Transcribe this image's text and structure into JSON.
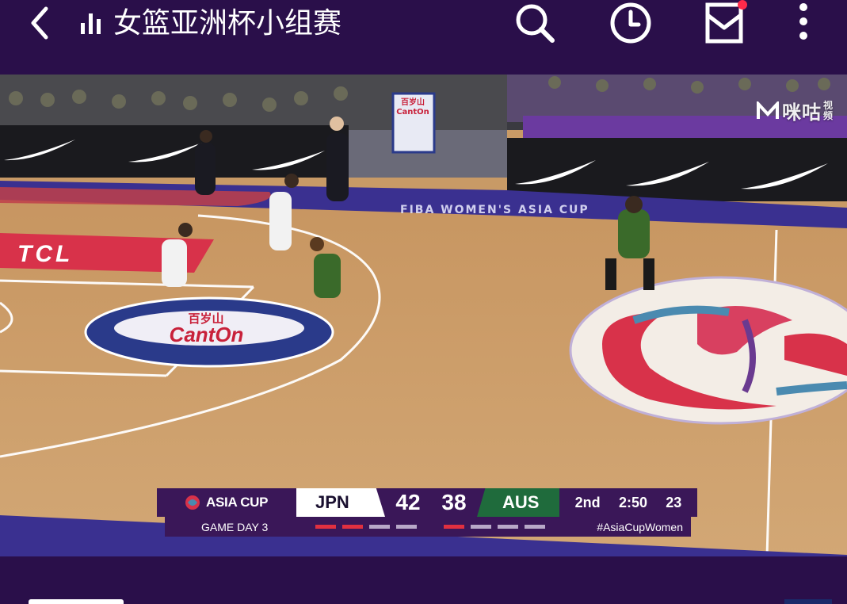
{
  "appbar": {
    "back_icon": "chevron-left-icon",
    "live_icon": "signal-bars-icon",
    "title": "女篮亚洲杯小组赛",
    "actions": [
      {
        "name": "search-icon"
      },
      {
        "name": "history-clock-icon"
      },
      {
        "name": "inbox-icon",
        "has_badge": true
      },
      {
        "name": "more-vertical-icon"
      }
    ],
    "badge_color": "#ff2a4a"
  },
  "video": {
    "watermark_brand": "咪咕",
    "watermark_sub": "视频",
    "ad_board_text": "FIBA WOMEN'S ASIA CUP",
    "court_logo_left": "TCL",
    "center_logo_top": "百岁山",
    "center_logo_main": "CantOn",
    "pillar_text": "百岁山 CantOn"
  },
  "scoreboard": {
    "event": "ASIA CUP",
    "home_team": "JPN",
    "home_score": "42",
    "away_score": "38",
    "away_team": "AUS",
    "period": "2nd",
    "game_clock": "2:50",
    "shot_clock": "23",
    "game_day": "GAME DAY 3",
    "hashtag": "#AsiaCupWomen",
    "home_fouls": 2,
    "away_fouls": 1,
    "home_color": "#ffffff",
    "away_color": "#1f6b3c",
    "bar_color": "#3a1758",
    "foul_on_color": "#e03040"
  }
}
